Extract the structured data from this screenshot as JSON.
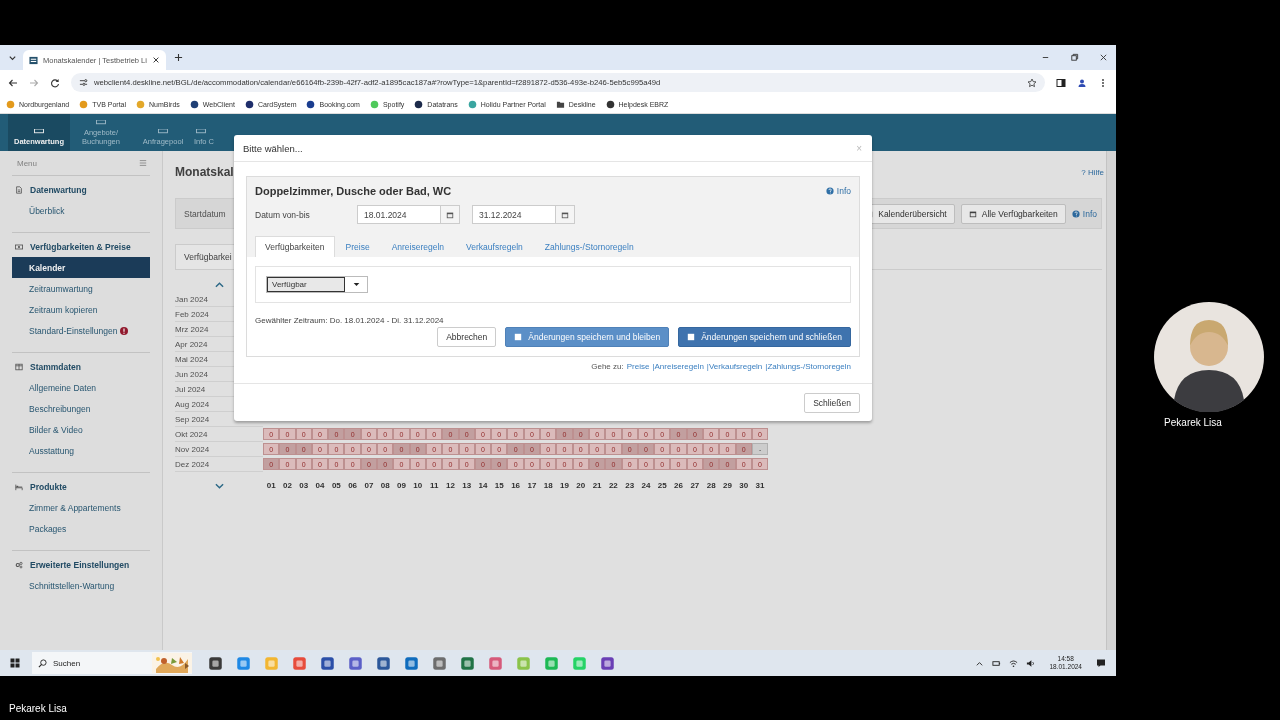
{
  "browser": {
    "tab_title": "Monatskalender | Testbetrieb Li",
    "url": "webclient4.deskline.net/BGL/de/accommodation/calendar/e66164fb-239b-42f7-adf2-a1895cac187a#?rowType=1&parentId=f2891872-d536-493e-b246-5eb5c995a49d",
    "bookmarks": [
      {
        "label": "Nordburgenland",
        "kind": "site",
        "color": "#e39a1c"
      },
      {
        "label": "TVB Portal",
        "kind": "site",
        "color": "#e39a1c"
      },
      {
        "label": "NumBirds",
        "kind": "site",
        "color": "#e3a82a"
      },
      {
        "label": "WebClient",
        "kind": "site",
        "color": "#1f3f75"
      },
      {
        "label": "CardSystem",
        "kind": "site",
        "color": "#1f2e6b"
      },
      {
        "label": "Booking.com",
        "kind": "site",
        "color": "#1a3d8f"
      },
      {
        "label": "Spotify",
        "kind": "site",
        "color": "#4fc95b"
      },
      {
        "label": "Datatrans",
        "kind": "site",
        "color": "#1c2a4a"
      },
      {
        "label": "Holidu Partner Portal",
        "kind": "site",
        "color": "#3aa5a0"
      },
      {
        "label": "Deskline",
        "kind": "folder",
        "color": "#444444"
      },
      {
        "label": "Helpdesk EBRZ",
        "kind": "site",
        "color": "#333333"
      }
    ]
  },
  "app": {
    "nav": [
      {
        "label": "Datenwartung",
        "selected": true
      },
      {
        "label": "Angebote/ Buchungen",
        "selected": false
      },
      {
        "label": "Anfragepool",
        "selected": false
      },
      {
        "label": "Info C",
        "selected": false
      }
    ],
    "sidebar": {
      "title": "Menu",
      "sections": [
        {
          "heading": "Datenwartung",
          "items": [
            {
              "label": "Überblick",
              "selected": false,
              "alert": false
            }
          ]
        },
        {
          "heading": "Verfügbarkeiten & Preise",
          "items": [
            {
              "label": "Kalender",
              "selected": true,
              "alert": false
            },
            {
              "label": "Zeitraumwartung",
              "selected": false,
              "alert": false
            },
            {
              "label": "Zeitraum kopieren",
              "selected": false,
              "alert": false
            },
            {
              "label": "Standard-Einstellungen",
              "selected": false,
              "alert": true
            }
          ]
        },
        {
          "heading": "Stammdaten",
          "items": [
            {
              "label": "Allgemeine Daten",
              "selected": false,
              "alert": false
            },
            {
              "label": "Beschreibungen",
              "selected": false,
              "alert": false
            },
            {
              "label": "Bilder & Video",
              "selected": false,
              "alert": false
            },
            {
              "label": "Ausstattung",
              "selected": false,
              "alert": false
            }
          ]
        },
        {
          "heading": "Produkte",
          "items": [
            {
              "label": "Zimmer & Appartements",
              "selected": false,
              "alert": false
            },
            {
              "label": "Packages",
              "selected": false,
              "alert": false
            }
          ]
        },
        {
          "heading": "Erweiterte Einstellungen",
          "items": [
            {
              "label": "Schnittstellen-Wartung",
              "selected": false,
              "alert": false
            }
          ]
        }
      ]
    },
    "page": {
      "title": "Monatskal",
      "help": "? Hilfe",
      "start_label": "Startdatum",
      "buttons": [
        "Kalenderübersicht",
        "Alle Verfügbarkeiten"
      ],
      "info": "Info",
      "tab": "Verfügbarkei",
      "calendar": {
        "months": [
          {
            "label": "Jan 2024"
          },
          {
            "label": "Feb 2024"
          },
          {
            "label": "Mrz 2024"
          },
          {
            "label": "Apr 2024"
          },
          {
            "label": "Mai 2024"
          },
          {
            "label": "Jun 2024"
          },
          {
            "label": "Jul 2024"
          },
          {
            "label": "Aug 2024"
          },
          {
            "label": "Sep 2024"
          },
          {
            "label": "Okt 2024",
            "cells": [
              {
                "value": "0",
                "kind": "free"
              },
              {
                "value": "0",
                "kind": "free"
              },
              {
                "value": "0",
                "kind": "free"
              },
              {
                "value": "0",
                "kind": "free"
              },
              {
                "value": "0",
                "kind": "weekend"
              },
              {
                "value": "0",
                "kind": "weekend"
              },
              {
                "value": "0",
                "kind": "free"
              },
              {
                "value": "0",
                "kind": "free"
              },
              {
                "value": "0",
                "kind": "free"
              },
              {
                "value": "0",
                "kind": "free"
              },
              {
                "value": "0",
                "kind": "free"
              },
              {
                "value": "0",
                "kind": "weekend"
              },
              {
                "value": "0",
                "kind": "weekend"
              },
              {
                "value": "0",
                "kind": "free"
              },
              {
                "value": "0",
                "kind": "free"
              },
              {
                "value": "0",
                "kind": "free"
              },
              {
                "value": "0",
                "kind": "free"
              },
              {
                "value": "0",
                "kind": "free"
              },
              {
                "value": "0",
                "kind": "weekend"
              },
              {
                "value": "0",
                "kind": "weekend"
              },
              {
                "value": "0",
                "kind": "free"
              },
              {
                "value": "0",
                "kind": "free"
              },
              {
                "value": "0",
                "kind": "free"
              },
              {
                "value": "0",
                "kind": "free"
              },
              {
                "value": "0",
                "kind": "free"
              },
              {
                "value": "0",
                "kind": "weekend"
              },
              {
                "value": "0",
                "kind": "weekend"
              },
              {
                "value": "0",
                "kind": "free"
              },
              {
                "value": "0",
                "kind": "free"
              },
              {
                "value": "0",
                "kind": "free"
              },
              {
                "value": "0",
                "kind": "free"
              }
            ]
          },
          {
            "label": "Nov 2024",
            "cells": [
              {
                "value": "0",
                "kind": "free"
              },
              {
                "value": "0",
                "kind": "weekend"
              },
              {
                "value": "0",
                "kind": "weekend"
              },
              {
                "value": "0",
                "kind": "free"
              },
              {
                "value": "0",
                "kind": "free"
              },
              {
                "value": "0",
                "kind": "free"
              },
              {
                "value": "0",
                "kind": "free"
              },
              {
                "value": "0",
                "kind": "free"
              },
              {
                "value": "0",
                "kind": "weekend"
              },
              {
                "value": "0",
                "kind": "weekend"
              },
              {
                "value": "0",
                "kind": "free"
              },
              {
                "value": "0",
                "kind": "free"
              },
              {
                "value": "0",
                "kind": "free"
              },
              {
                "value": "0",
                "kind": "free"
              },
              {
                "value": "0",
                "kind": "free"
              },
              {
                "value": "0",
                "kind": "weekend"
              },
              {
                "value": "0",
                "kind": "weekend"
              },
              {
                "value": "0",
                "kind": "free"
              },
              {
                "value": "0",
                "kind": "free"
              },
              {
                "value": "0",
                "kind": "free"
              },
              {
                "value": "0",
                "kind": "free"
              },
              {
                "value": "0",
                "kind": "free"
              },
              {
                "value": "0",
                "kind": "weekend"
              },
              {
                "value": "0",
                "kind": "weekend"
              },
              {
                "value": "0",
                "kind": "free"
              },
              {
                "value": "0",
                "kind": "free"
              },
              {
                "value": "0",
                "kind": "free"
              },
              {
                "value": "0",
                "kind": "free"
              },
              {
                "value": "0",
                "kind": "free"
              },
              {
                "value": "0",
                "kind": "weekend"
              },
              {
                "value": "-",
                "kind": "none"
              }
            ]
          },
          {
            "label": "Dez 2024",
            "cells": [
              {
                "value": "0",
                "kind": "weekend"
              },
              {
                "value": "0",
                "kind": "free"
              },
              {
                "value": "0",
                "kind": "free"
              },
              {
                "value": "0",
                "kind": "free"
              },
              {
                "value": "0",
                "kind": "free"
              },
              {
                "value": "0",
                "kind": "free"
              },
              {
                "value": "0",
                "kind": "weekend"
              },
              {
                "value": "0",
                "kind": "weekend"
              },
              {
                "value": "0",
                "kind": "free"
              },
              {
                "value": "0",
                "kind": "free"
              },
              {
                "value": "0",
                "kind": "free"
              },
              {
                "value": "0",
                "kind": "free"
              },
              {
                "value": "0",
                "kind": "free"
              },
              {
                "value": "0",
                "kind": "weekend"
              },
              {
                "value": "0",
                "kind": "weekend"
              },
              {
                "value": "0",
                "kind": "free"
              },
              {
                "value": "0",
                "kind": "free"
              },
              {
                "value": "0",
                "kind": "free"
              },
              {
                "value": "0",
                "kind": "free"
              },
              {
                "value": "0",
                "kind": "free"
              },
              {
                "value": "0",
                "kind": "weekend"
              },
              {
                "value": "0",
                "kind": "weekend"
              },
              {
                "value": "0",
                "kind": "free"
              },
              {
                "value": "0",
                "kind": "free"
              },
              {
                "value": "0",
                "kind": "free"
              },
              {
                "value": "0",
                "kind": "free"
              },
              {
                "value": "0",
                "kind": "free"
              },
              {
                "value": "0",
                "kind": "weekend"
              },
              {
                "value": "0",
                "kind": "weekend"
              },
              {
                "value": "0",
                "kind": "free"
              },
              {
                "value": "0",
                "kind": "free"
              }
            ]
          }
        ],
        "days": [
          "01",
          "02",
          "03",
          "04",
          "05",
          "06",
          "07",
          "08",
          "09",
          "10",
          "11",
          "12",
          "13",
          "14",
          "15",
          "16",
          "17",
          "18",
          "19",
          "20",
          "21",
          "22",
          "23",
          "24",
          "25",
          "26",
          "27",
          "28",
          "29",
          "30",
          "31"
        ]
      }
    },
    "dialog": {
      "title": "Bitte wählen...",
      "close": "×",
      "product": "Doppelzimmer, Dusche oder Bad, WC",
      "info": "Info",
      "date_label": "Datum von-bis",
      "date_from": "18.01.2024",
      "date_to": "31.12.2024",
      "tabs": [
        {
          "label": "Verfügbarkeiten",
          "selected": true
        },
        {
          "label": "Preise",
          "selected": false
        },
        {
          "label": "Anreiseregeln",
          "selected": false
        },
        {
          "label": "Verkaufsregeln",
          "selected": false
        },
        {
          "label": "Zahlungs-/Stornoregeln",
          "selected": false
        }
      ],
      "status": "Verfügbar",
      "period": "Gewählter Zeitraum: Do. 18.01.2024 - Di. 31.12.2024",
      "buttons": [
        {
          "label": "Abbrechen",
          "kind": "default",
          "hovered": false
        },
        {
          "label": "Änderungen speichern und bleiben",
          "kind": "primary",
          "hovered": false
        },
        {
          "label": "Änderungen speichern und schließen",
          "kind": "primary",
          "hovered": true
        }
      ],
      "goto_label": "Gehe zu:",
      "goto_links": [
        "Preise",
        "|Anreiseregeln",
        "|Verkaufsregeln",
        "|Zahlungs-/Stornoregeln"
      ],
      "footer_button": "Schließen"
    }
  },
  "taskbar": {
    "search_placeholder": "Suchen",
    "time": "14:58",
    "date": "18.01.2024"
  },
  "call": {
    "tile_name": "Pekarek Lisa",
    "presenter_name": "Pekarek Lisa"
  }
}
